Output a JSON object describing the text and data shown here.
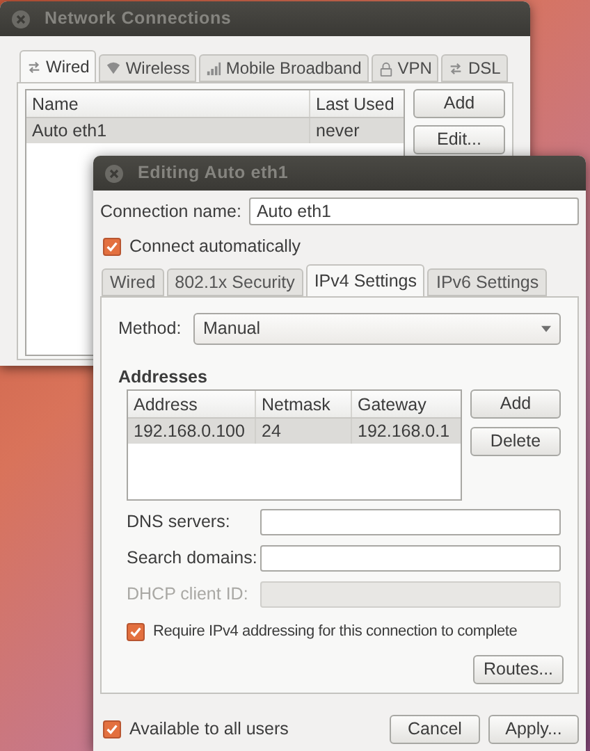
{
  "main_window": {
    "title": "Network Connections",
    "tabs": [
      {
        "label": "Wired",
        "selected": true,
        "kind": "wired"
      },
      {
        "label": "Wireless",
        "selected": false,
        "kind": "wireless"
      },
      {
        "label": "Mobile Broadband",
        "selected": false,
        "kind": "mobile"
      },
      {
        "label": "VPN",
        "selected": false,
        "kind": "vpn"
      },
      {
        "label": "DSL",
        "selected": false,
        "kind": "dsl"
      }
    ],
    "table": {
      "columns": [
        "Name",
        "Last Used"
      ],
      "rows": [
        {
          "cells": [
            "Auto eth1",
            "never"
          ],
          "selected": true
        }
      ]
    },
    "buttons": [
      "Add",
      "Edit..."
    ]
  },
  "editor_window": {
    "title": "Editing Auto eth1",
    "connection_name": {
      "label": "Connection name:",
      "value": "Auto eth1"
    },
    "connect_automatically": {
      "label": "Connect automatically",
      "checked": true
    },
    "tabs": [
      {
        "label": "Wired",
        "selected": false
      },
      {
        "label": "802.1x Security",
        "selected": false
      },
      {
        "label": "IPv4 Settings",
        "selected": true
      },
      {
        "label": "IPv6 Settings",
        "selected": false
      }
    ],
    "method": {
      "label": "Method:",
      "value": "Manual"
    },
    "addresses": {
      "heading": "Addresses",
      "columns": [
        "Address",
        "Netmask",
        "Gateway"
      ],
      "rows": [
        {
          "cells": [
            "192.168.0.100",
            "24",
            "192.168.0.1"
          ],
          "selected": true
        }
      ],
      "buttons": [
        "Add",
        "Delete"
      ]
    },
    "fields": [
      {
        "label": "DNS servers:",
        "disabled": false
      },
      {
        "label": "Search domains:",
        "disabled": false
      },
      {
        "label": "DHCP client ID:",
        "disabled": true
      }
    ],
    "require_ipv4": {
      "label": "Require IPv4 addressing for this connection to complete",
      "checked": true
    },
    "routes_button": "Routes...",
    "available_to_all": {
      "label": "Available to all users",
      "checked": true
    },
    "buttons": [
      "Cancel",
      "Apply..."
    ]
  }
}
